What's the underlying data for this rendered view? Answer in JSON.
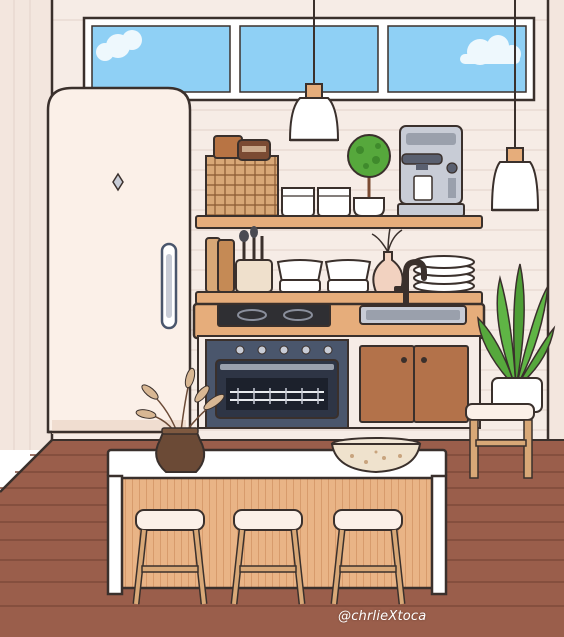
{
  "scene": {
    "watermark": "@chrlieXtoca",
    "colors": {
      "wall": "#f6ece6",
      "wall_plank_line": "#e6d7cf",
      "floor": "#9a5e4b",
      "floor_line": "#7e4a3a",
      "outline": "#3a302c",
      "wood_light": "#e6ad7b",
      "wood_dark": "#b87444",
      "cabinet_brown": "#b3724a",
      "fridge": "#fbf0e8",
      "sky": "#8fd0f5",
      "plant_green": "#56a83c",
      "oven_blue": "#4a566c",
      "steel": "#c8ccd6"
    },
    "icons": [
      "fridge",
      "pendant-lamp",
      "espresso-machine",
      "topiary-plant",
      "wicker-basket",
      "bowls",
      "plates",
      "faucet",
      "sink",
      "stove-top",
      "oven",
      "snake-plant",
      "stool",
      "vase",
      "bowl",
      "utensil-crock"
    ]
  }
}
